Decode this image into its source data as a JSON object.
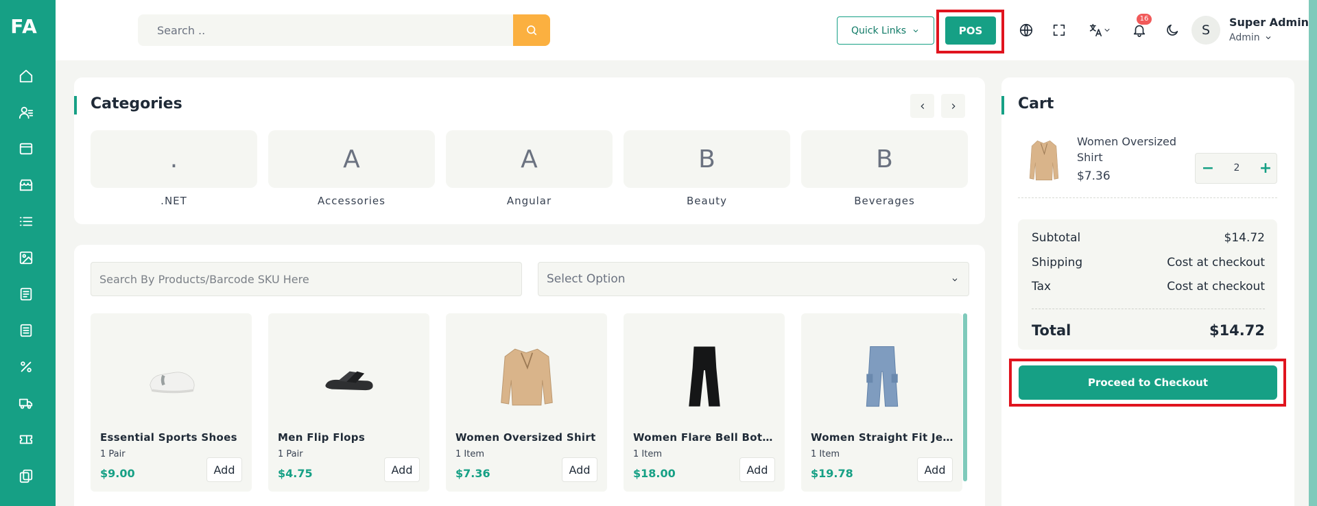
{
  "sidebar": {
    "logo": "FA",
    "icons": [
      "home-icon",
      "users-icon",
      "store-icon",
      "shop-icon",
      "list-icon",
      "image-icon",
      "document-icon",
      "receipt-icon",
      "percent-icon",
      "truck-icon",
      "ticket-icon",
      "copy-icon"
    ]
  },
  "header": {
    "search_placeholder": "Search ..",
    "quick_links": "Quick Links",
    "pos": "POS",
    "notification_count": "16",
    "avatar_initial": "S",
    "user_name": "Super Admin",
    "user_role": "Admin"
  },
  "categories": {
    "title": "Categories",
    "items": [
      {
        "initial": ".",
        "label": ".NET"
      },
      {
        "initial": "A",
        "label": "Accessories"
      },
      {
        "initial": "A",
        "label": "Angular"
      },
      {
        "initial": "B",
        "label": "Beauty"
      },
      {
        "initial": "B",
        "label": "Beverages"
      }
    ]
  },
  "products": {
    "search_placeholder": "Search By Products/Barcode SKU Here",
    "select_placeholder": "Select Option",
    "add_label": "Add",
    "items": [
      {
        "name": "Essential Sports Shoes",
        "unit": "1 Pair",
        "price": "$9.00"
      },
      {
        "name": "Men Flip Flops",
        "unit": "1 Pair",
        "price": "$4.75"
      },
      {
        "name": "Women Oversized Shirt",
        "unit": "1 Item",
        "price": "$7.36"
      },
      {
        "name": "Women Flare Bell Bottom…",
        "unit": "1 Item",
        "price": "$18.00"
      },
      {
        "name": "Women Straight Fit Jeans",
        "unit": "1 Item",
        "price": "$19.78"
      }
    ]
  },
  "cart": {
    "title": "Cart",
    "item": {
      "name": "Women Oversized Shirt",
      "price": "$7.36",
      "qty": "2"
    },
    "subtotal_label": "Subtotal",
    "subtotal": "$14.72",
    "shipping_label": "Shipping",
    "shipping": "Cost at checkout",
    "tax_label": "Tax",
    "tax": "Cost at checkout",
    "total_label": "Total",
    "total": "$14.72",
    "checkout": "Proceed to Checkout"
  }
}
